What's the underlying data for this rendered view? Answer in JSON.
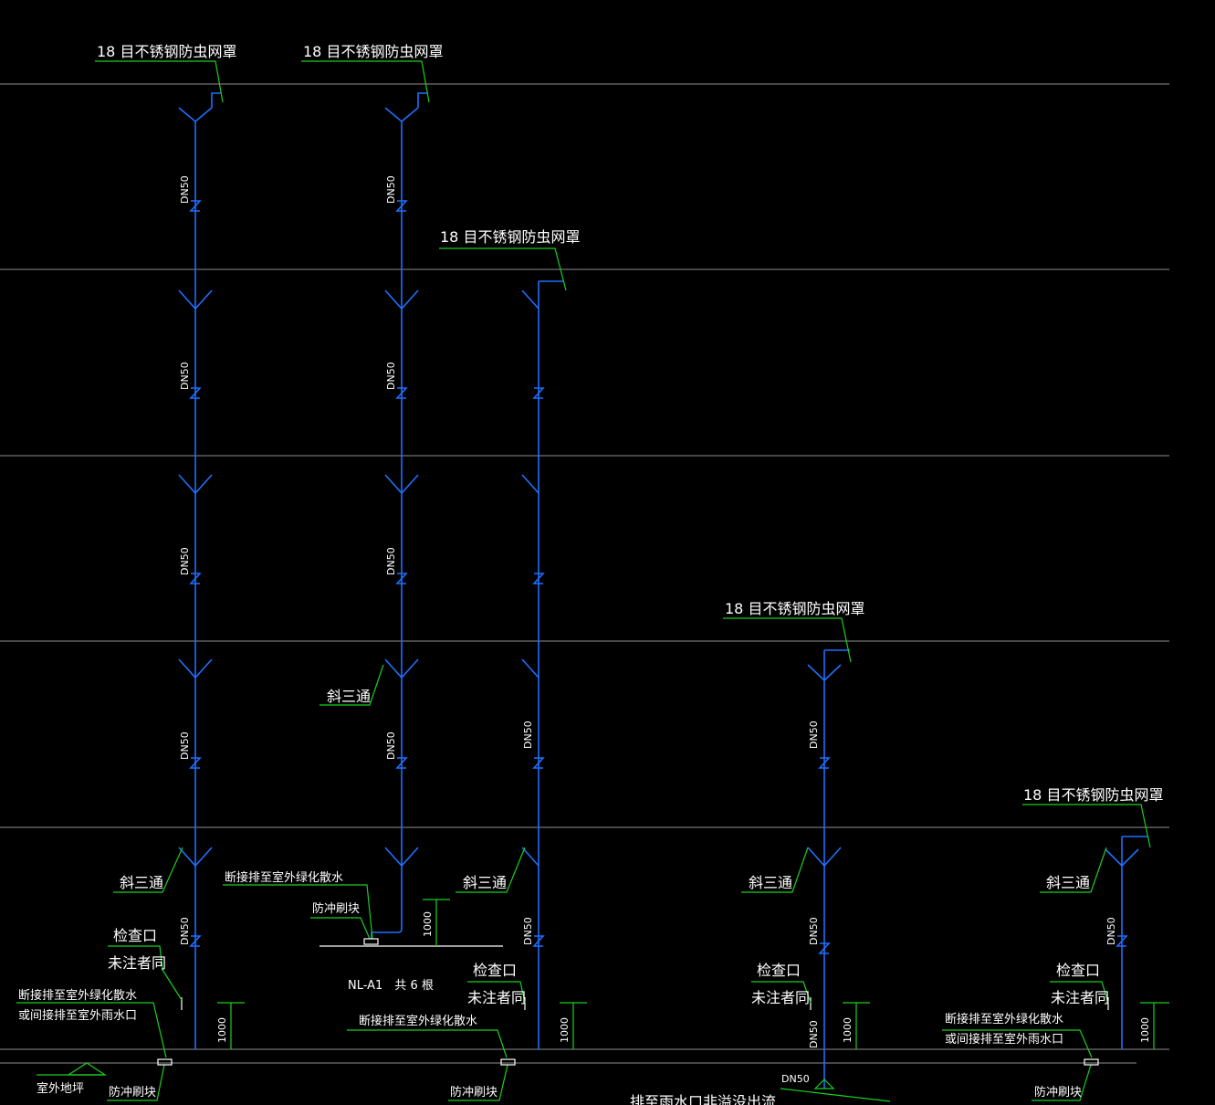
{
  "labels": {
    "mesh": "18 目不锈钢防虫网罩",
    "pipe_size": "DN50",
    "wye_tee": "斜三通",
    "cleanout": "检查口",
    "not_noted": "未注者同",
    "discharge_green": "断接排至室外绿化散水",
    "discharge_rain": "或间接排至室外雨水口",
    "splash_block": "防冲刷块",
    "dim_1000": "1000",
    "riser_tag": "NL-A1　共 6 根",
    "outdoor_ground": "室外地坪",
    "drain_to_rain": "排至雨水口非溢没出流"
  },
  "colors": {
    "background": "#000000",
    "pipe": "#1f6fff",
    "leader": "#19d01f",
    "floor_line": "#8f8f8f",
    "text": "#ffffff"
  }
}
